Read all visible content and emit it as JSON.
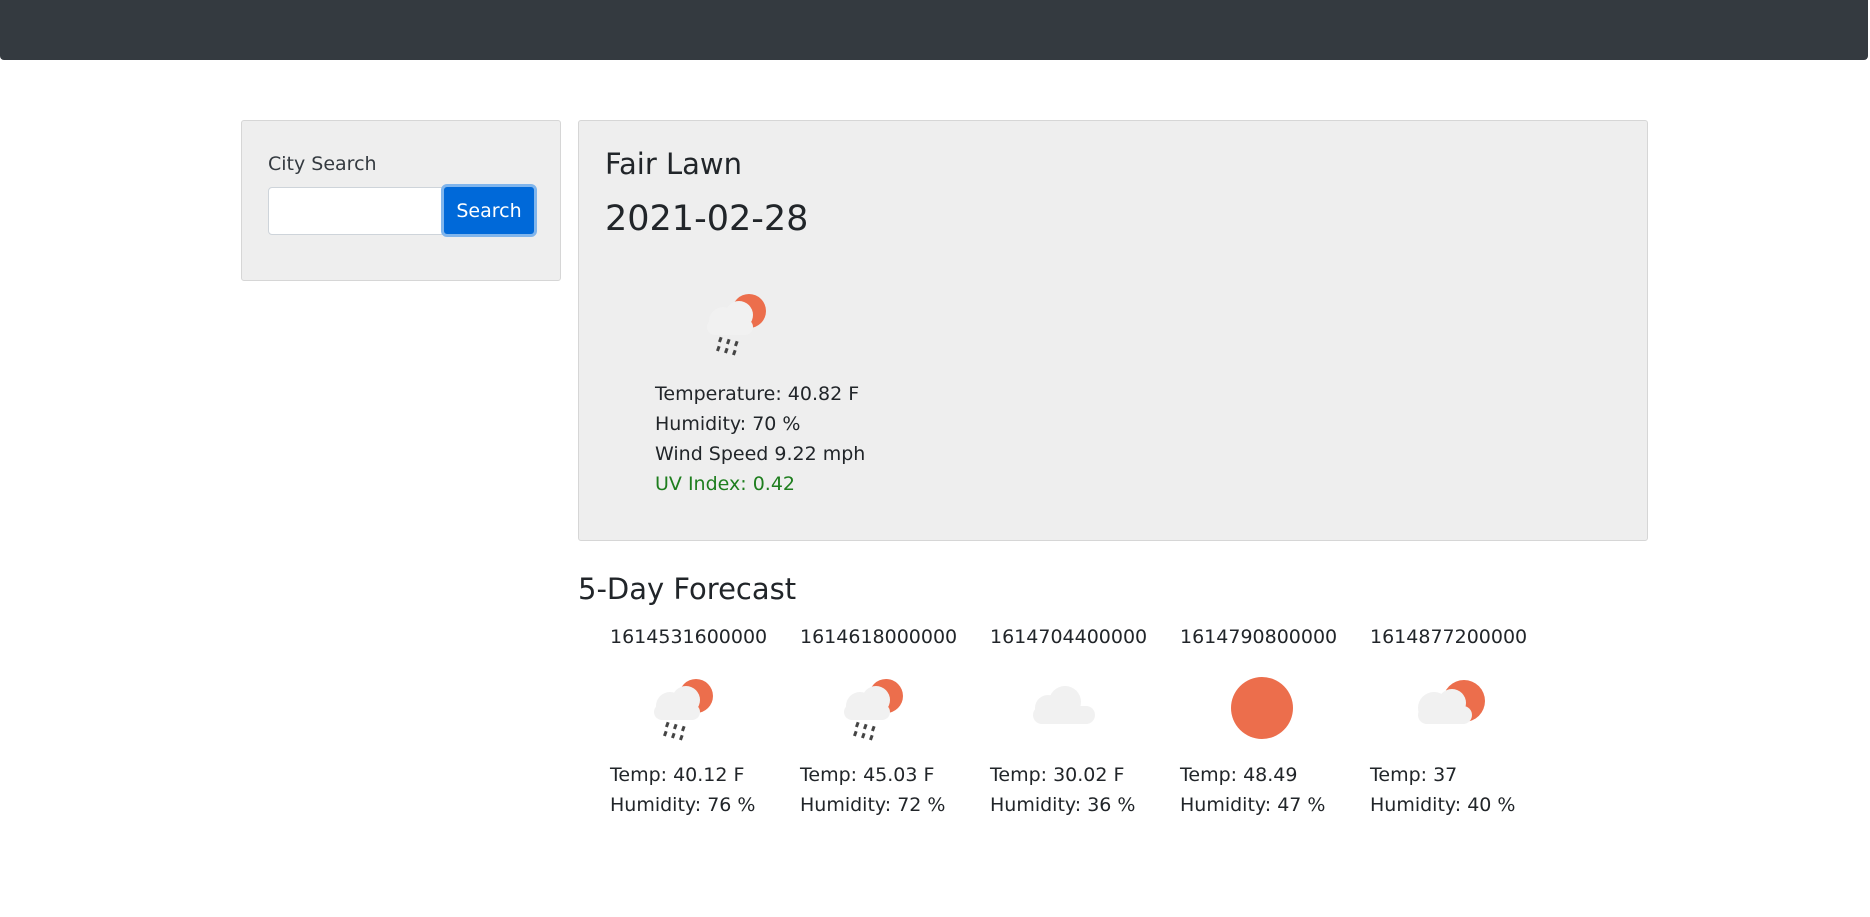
{
  "search": {
    "label": "City Search",
    "button_label": "Search",
    "value": "",
    "placeholder": ""
  },
  "current": {
    "city": "Fair Lawn",
    "date": "2021-02-28",
    "icon": "rain-sun-icon",
    "temperature": "Temperature: 40.82 F",
    "humidity": "Humidity: 70 %",
    "wind": "Wind Speed 9.22 mph",
    "uv": "UV Index: 0.42",
    "uv_color": "#1e7e1e"
  },
  "forecast": {
    "title": "5-Day Forecast",
    "days": [
      {
        "date": "1614531600000",
        "icon": "rain-sun-icon",
        "temp": "Temp: 40.12 F",
        "humidity": "Humidity: 76 %"
      },
      {
        "date": "1614618000000",
        "icon": "rain-sun-icon",
        "temp": "Temp: 45.03 F",
        "humidity": "Humidity: 72 %"
      },
      {
        "date": "1614704400000",
        "icon": "cloud-icon",
        "temp": "Temp: 30.02 F",
        "humidity": "Humidity: 36 %"
      },
      {
        "date": "1614790800000",
        "icon": "sun-icon",
        "temp": "Temp: 48.49",
        "humidity": "Humidity: 47 %"
      },
      {
        "date": "1614877200000",
        "icon": "partly-cloudy-icon",
        "temp": "Temp: 37",
        "humidity": "Humidity: 40 %"
      }
    ]
  },
  "colors": {
    "navbar": "#343a40",
    "primary_button": "#0069d9",
    "sun": "#ec6e4c",
    "cloud": "#f1f1f1",
    "card_background": "#eeeeee"
  }
}
